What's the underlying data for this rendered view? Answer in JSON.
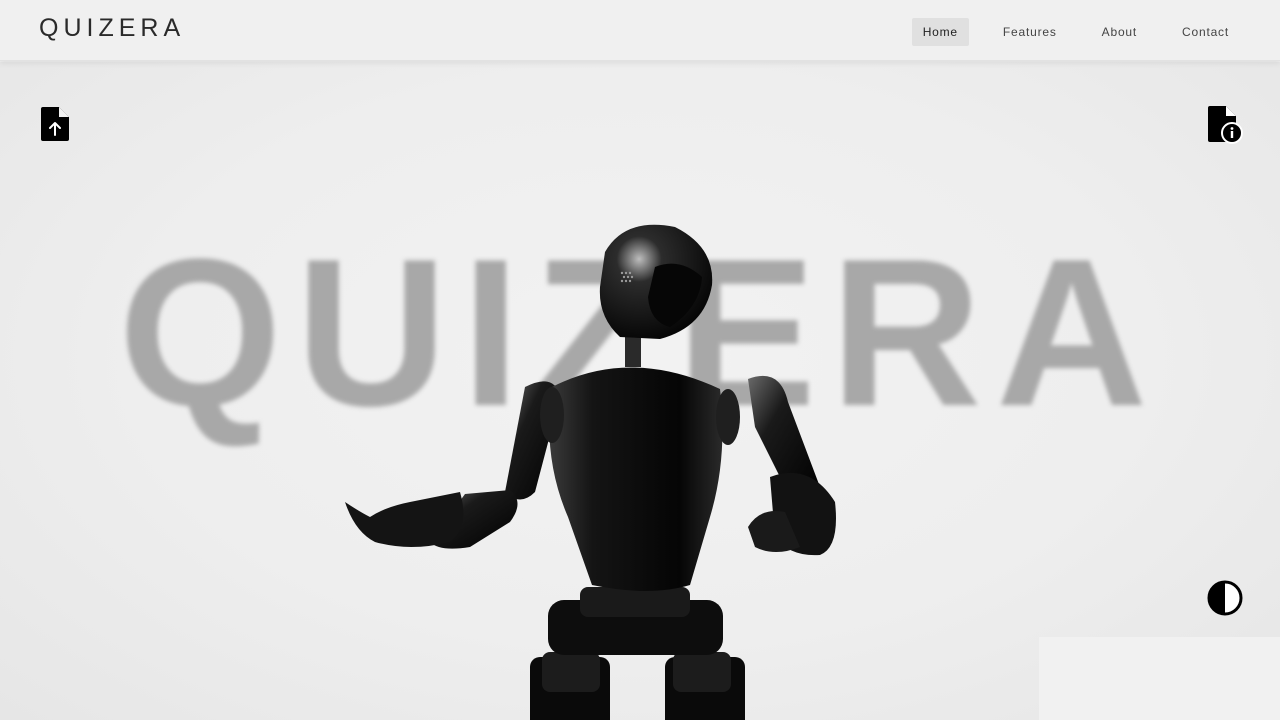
{
  "navbar": {
    "brand": "QUIZERA",
    "links": [
      {
        "label": "Home",
        "active": true
      },
      {
        "label": "Features",
        "active": false
      },
      {
        "label": "About",
        "active": false
      },
      {
        "label": "Contact",
        "active": false
      }
    ]
  },
  "hero": {
    "background_word": "QUIZERA",
    "icons": {
      "upload": "file-upload-icon",
      "info": "file-info-icon",
      "theme": "contrast-icon"
    }
  },
  "colors": {
    "background": "#efefef",
    "text": "#2a2a2a",
    "bg_word": "#a8a8a8",
    "icon": "#000000",
    "active_nav": "#e0e0e0"
  }
}
